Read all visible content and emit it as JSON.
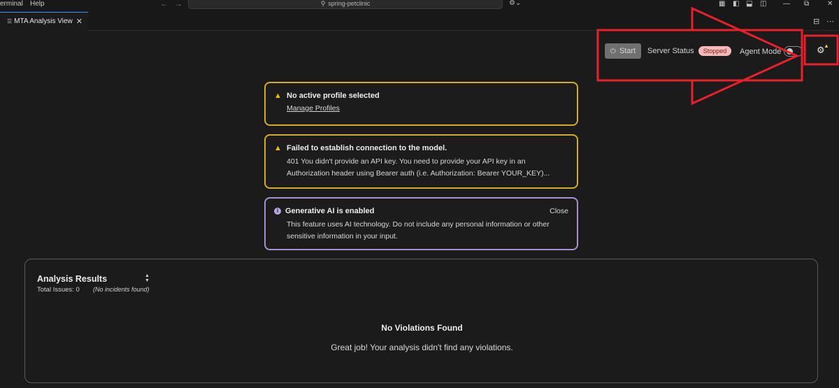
{
  "menu": {
    "terminal": "erminal",
    "help": "Help"
  },
  "search": {
    "text": "spring-petclinic"
  },
  "tab": {
    "label": "MTA Analysis View"
  },
  "toolbar": {
    "start_label": "Start",
    "server_status_label": "Server Status",
    "server_status_value": "Stopped",
    "agent_mode_label": "Agent Mode",
    "agent_mode_on": false
  },
  "alerts": {
    "profile": {
      "title": "No active profile selected",
      "link": "Manage Profiles"
    },
    "connection": {
      "title": "Failed to establish connection to the model.",
      "line1": "401 You didn't provide an API key. You need to provide your API key in an",
      "line2": "Authorization header using Bearer auth (i.e. Authorization: Bearer YOUR_KEY)..."
    },
    "genai": {
      "title": "Generative AI is enabled",
      "close": "Close",
      "line1": "This feature uses AI technology. Do not include any personal information or other",
      "line2": "sensitive information in your input."
    }
  },
  "results": {
    "title": "Analysis Results",
    "total_issues": "Total Issues: 0",
    "no_incidents": "(No incidents found)",
    "empty_title": "No Violations Found",
    "empty_message": "Great job! Your analysis didn't find any violations."
  },
  "colors": {
    "annotation": "#e8202a",
    "warning_border": "#d6ab25",
    "info_border": "#a88fcf",
    "stopped_badge": "#f7b8b8",
    "tab_accent": "#3794ff"
  }
}
